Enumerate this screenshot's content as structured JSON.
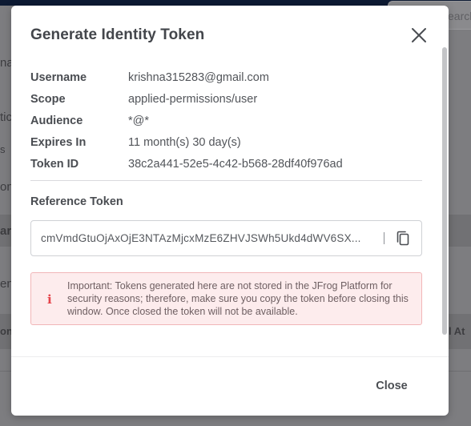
{
  "background": {
    "search_placeholder": "earch",
    "fragments": [
      "nal",
      "tic",
      "s",
      "on",
      "ar",
      "en",
      "on",
      "l At"
    ]
  },
  "modal": {
    "title": "Generate Identity Token",
    "details": [
      {
        "label": "Username",
        "value": "krishna315283@gmail.com"
      },
      {
        "label": "Scope",
        "value": "applied-permissions/user"
      },
      {
        "label": "Audience",
        "value": "*@*"
      },
      {
        "label": "Expires In",
        "value": "11 month(s) 30 day(s)"
      },
      {
        "label": "Token ID",
        "value": "38c2a441-52e5-4c42-b568-28df40f976ad"
      }
    ],
    "reference_token_label": "Reference Token",
    "reference_token_value": "cmVmdGtuOjAxOjE3NTAzMjcxMzE6ZHVJSWh5Ukd4dWV6SX...",
    "alert": {
      "icon": "info-icon",
      "text": "Important: Tokens generated here are not stored in the JFrog Platform for security reasons; therefore, make sure you copy the token before closing this window. Once closed the token will not be available."
    },
    "close_button_label": "Close"
  },
  "colors": {
    "overlay": "#7d7d80",
    "topbar": "#0d1a33",
    "alert_bg": "#fdeced",
    "alert_border": "#f1b6b8",
    "alert_icon": "#e5434a"
  }
}
